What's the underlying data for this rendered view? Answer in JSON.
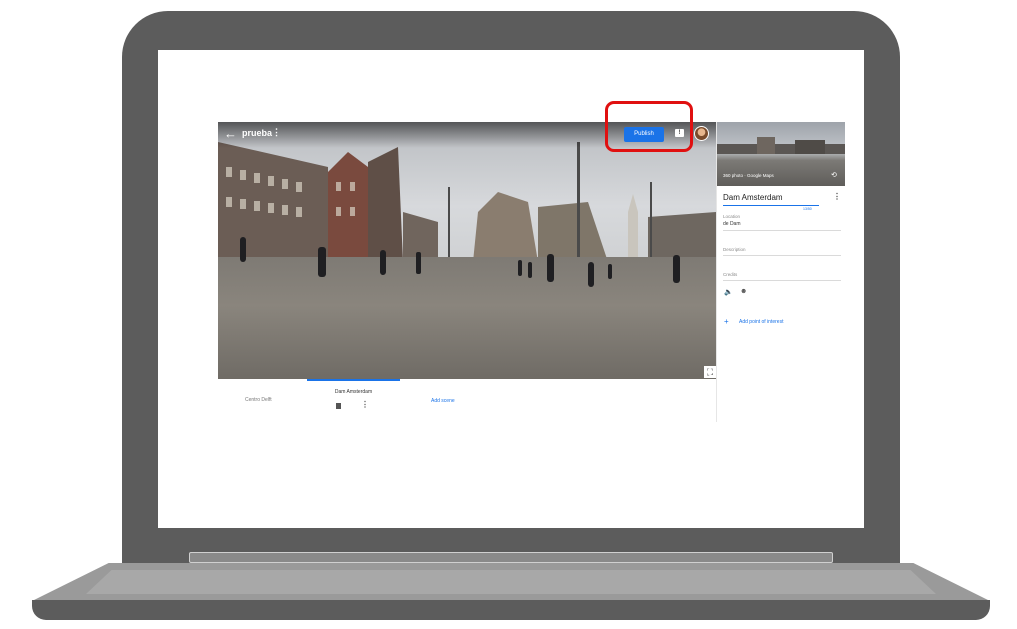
{
  "header": {
    "project_title": "prueba",
    "back_icon": "arrow-back-icon",
    "more_icon": "more-vert-icon",
    "publish_label": "Publish",
    "feedback_icon": "feedback-icon",
    "highlight_color": "#e01010",
    "accent_color": "#1a73e8"
  },
  "scenes": {
    "items": [
      {
        "label": "Centro Delft"
      },
      {
        "label": "Dam Amsterdam"
      }
    ],
    "add_label": "Add scene"
  },
  "panel": {
    "thumbnail_caption": "360 photo · Google Maps",
    "scene_name": "Dam Amsterdam",
    "char_count": "13/50",
    "location_label": "Location",
    "location_value": "de Dam",
    "description_label": "Description",
    "credits_label": "Credits",
    "add_poi_label": "Add point of interest"
  }
}
